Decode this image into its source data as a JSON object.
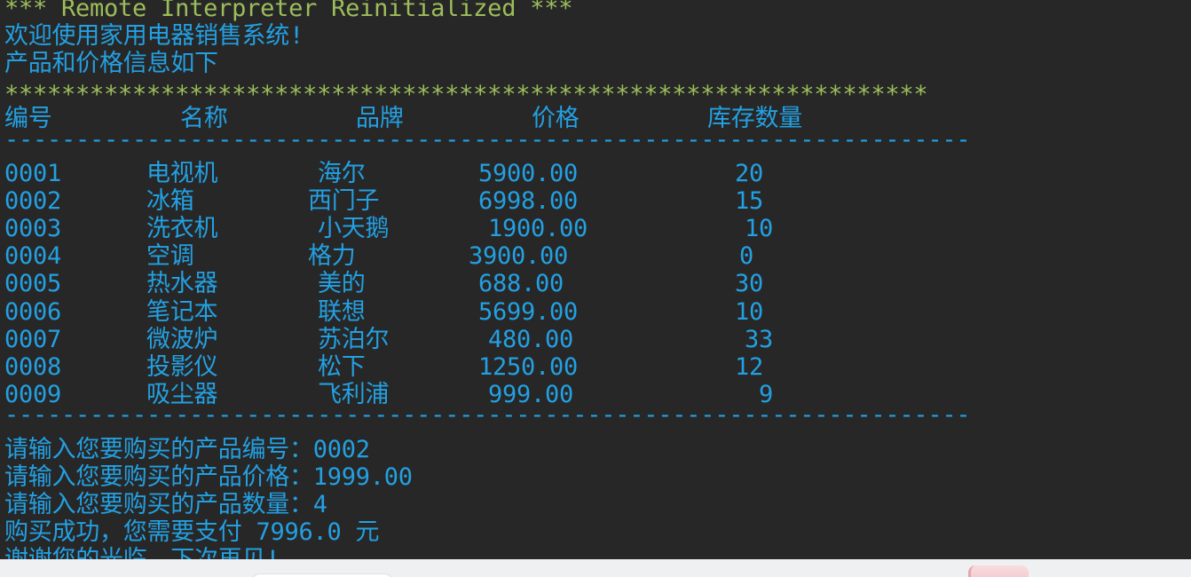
{
  "colors": {
    "background": "#272727",
    "banner_text": "#9CBD5B",
    "output_text": "#23A0E2",
    "bottom_panel": "#EEF0F2"
  },
  "console": {
    "banner": "*** Remote Interpreter Reinitialized ***",
    "welcome": "欢迎使用家用电器销售系统!",
    "intro": "产品和价格信息如下",
    "stars": "*****************************************************************",
    "divider": "--------------------------------------------------------------------"
  },
  "table": {
    "headers": [
      "编号",
      "名称",
      "品牌",
      "价格",
      "库存数量"
    ],
    "rows": [
      [
        "0001",
        "电视机",
        "海尔",
        "5900.00",
        "20"
      ],
      [
        "0002",
        "冰箱",
        "西门子",
        "6998.00",
        "15"
      ],
      [
        "0003",
        "洗衣机",
        "小天鹅",
        "1900.00",
        "10"
      ],
      [
        "0004",
        "空调",
        "格力",
        "3900.00",
        "0"
      ],
      [
        "0005",
        "热水器",
        "美的",
        "688.00",
        "30"
      ],
      [
        "0006",
        "笔记本",
        "联想",
        "5699.00",
        "10"
      ],
      [
        "0007",
        "微波炉",
        "苏泊尔",
        "480.00",
        "33"
      ],
      [
        "0008",
        "投影仪",
        "松下",
        "1250.00",
        "12"
      ],
      [
        "0009",
        "吸尘器",
        "飞利浦",
        "999.00",
        "9"
      ]
    ]
  },
  "purchase": {
    "code_prompt": "请输入您要购买的产品编号：",
    "code_value": "0002",
    "price_prompt": "请输入您要购买的产品价格：",
    "price_value": "1999.00",
    "quantity_prompt": "请输入您要购买的产品数量：",
    "quantity_value": "4",
    "result": "购买成功，您需要支付 7996.0 元",
    "farewell": "谢谢您的光临，下次再见!"
  }
}
